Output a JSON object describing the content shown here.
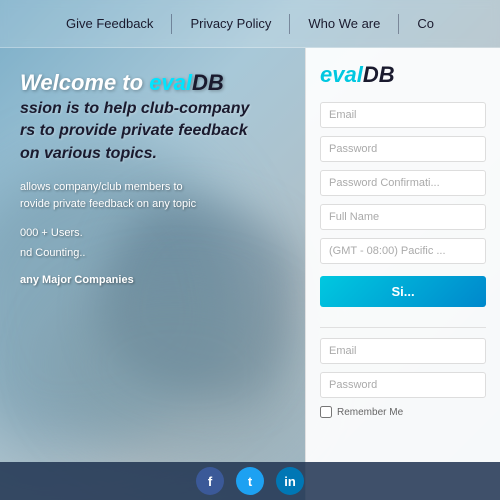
{
  "navbar": {
    "items": [
      {
        "label": "Give Feedback",
        "id": "nav-give-feedback"
      },
      {
        "label": "Privacy Policy",
        "id": "nav-privacy-policy"
      },
      {
        "label": "Who We are",
        "id": "nav-who-we-are"
      },
      {
        "label": "Co",
        "id": "nav-co"
      }
    ]
  },
  "hero": {
    "welcome_prefix": "Welcome to ",
    "brand_eval": "eval",
    "brand_db": "DB",
    "tagline_line1": "ssion is to help club-company",
    "tagline_line2": "rs to provide private feedback",
    "tagline_line3": "on various topics.",
    "desc_line1": "allows company/club members to",
    "desc_line2": "rovide private feedback on any topic",
    "stat1": "000 + Users.",
    "stat2": "nd Counting..",
    "companies": "any Major Companies"
  },
  "panel": {
    "logo_eval": "eval",
    "logo_db": "DB",
    "signup": {
      "email_placeholder": "Email",
      "password_placeholder": "Password",
      "password_confirm_placeholder": "Password Confirmati...",
      "fullname_placeholder": "Full Name",
      "timezone_placeholder": "(GMT - 08:00) Pacific ...",
      "button_label": "Si..."
    },
    "login": {
      "email_placeholder": "Email",
      "password_placeholder": "Password",
      "remember_label": "Remember Me"
    }
  },
  "footer": {
    "social": [
      {
        "label": "f",
        "id": "facebook",
        "color": "social-fb"
      },
      {
        "label": "t",
        "id": "twitter",
        "color": "social-tw"
      },
      {
        "label": "in",
        "id": "linkedin",
        "color": "social-li"
      }
    ]
  }
}
